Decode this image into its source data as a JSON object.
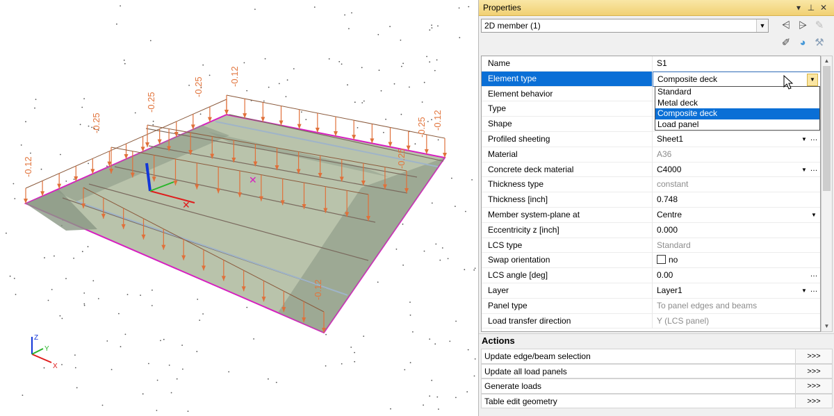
{
  "viewport": {
    "load_labels": [
      "-0.12",
      "-0.25",
      "-0.25",
      "-0.25",
      "-0.12",
      "-0.25",
      "-0.12",
      "-0.12",
      "-0.25",
      "-0.12",
      "-0.12"
    ],
    "axes": {
      "z": "Z",
      "y": "Y",
      "x": "X"
    },
    "colors": {
      "plate": "#b9c3ab",
      "plate_dark": "#8a9785",
      "edge": "#d61fc0",
      "load": "#e0703a",
      "label": "#e2753d"
    }
  },
  "properties": {
    "title": "Properties",
    "title_buttons": [
      "▾",
      "📌",
      "✕"
    ],
    "selection": "2D member (1)",
    "rows": [
      {
        "name": "Name",
        "value": "S1"
      },
      {
        "name": "Element type",
        "value": "Composite deck"
      },
      {
        "name": "Element behavior",
        "value": ""
      },
      {
        "name": "Type",
        "value": ""
      },
      {
        "name": "Shape",
        "value": ""
      },
      {
        "name": "Profiled sheeting",
        "value": "Sheet1"
      },
      {
        "name": "Material",
        "value": "A36"
      },
      {
        "name": "Concrete deck material",
        "value": "C4000"
      },
      {
        "name": "Thickness type",
        "value": "constant"
      },
      {
        "name": "Thickness [inch]",
        "value": "0.748"
      },
      {
        "name": "Member system-plane at",
        "value": "Centre"
      },
      {
        "name": "Eccentricity z [inch]",
        "value": "0.000"
      },
      {
        "name": "LCS type",
        "value": "Standard"
      },
      {
        "name": "Swap orientation",
        "value": "no"
      },
      {
        "name": "LCS angle [deg]",
        "value": "0.00"
      },
      {
        "name": "Layer",
        "value": "Layer1"
      },
      {
        "name": "Panel type",
        "value": "To panel edges and beams"
      },
      {
        "name": "Load transfer direction",
        "value": "Y (LCS panel)"
      }
    ],
    "element_type_options": [
      "Standard",
      "Metal deck",
      "Composite deck",
      "Load panel"
    ],
    "actions_title": "Actions",
    "actions": [
      {
        "label": "Update edge/beam selection",
        "go": ">>>"
      },
      {
        "label": "Update all load panels",
        "go": ">>>"
      },
      {
        "label": "Generate loads",
        "go": ">>>"
      },
      {
        "label": "Table edit geometry",
        "go": ">>>"
      }
    ]
  }
}
